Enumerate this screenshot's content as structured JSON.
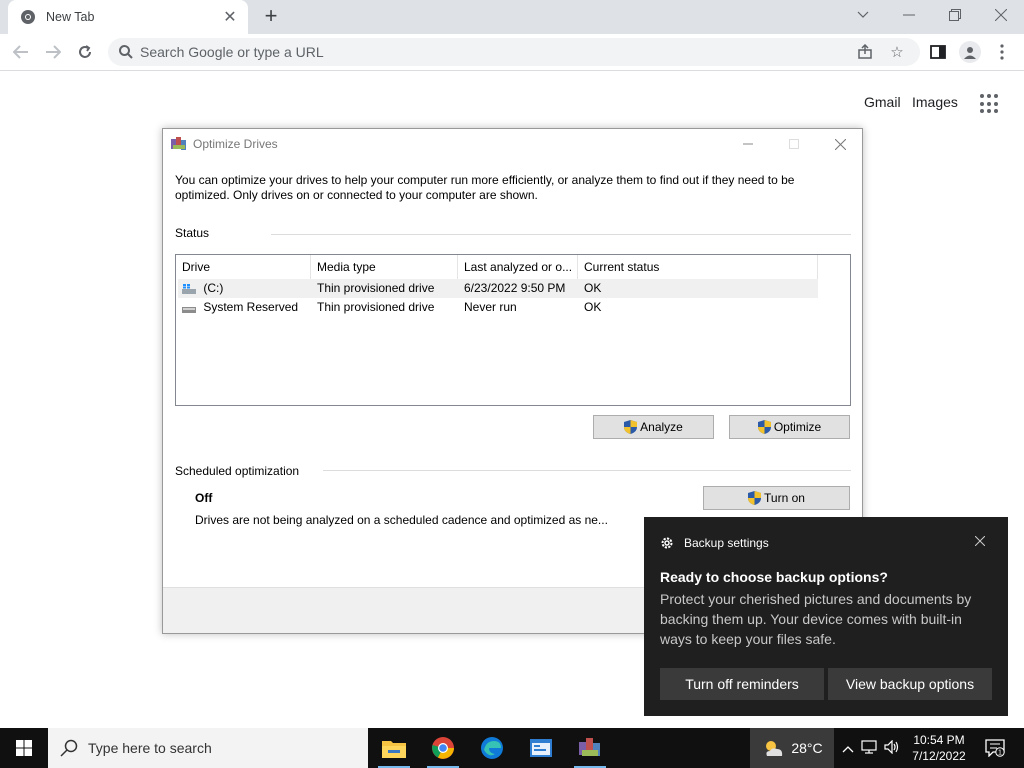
{
  "browser": {
    "tab_title": "New Tab",
    "omnibox_placeholder": "Search Google or type a URL",
    "ntp_links": {
      "gmail": "Gmail",
      "images": "Images"
    }
  },
  "dialog": {
    "title": "Optimize Drives",
    "description": "You can optimize your drives to help your computer run more efficiently, or analyze them to find out if they need to be optimized. Only drives on or connected to your computer are shown.",
    "status_label": "Status",
    "columns": [
      "Drive",
      "Media type",
      "Last analyzed or o...",
      "Current status"
    ],
    "drives": [
      {
        "drive": "(C:)",
        "media_type": "Thin provisioned drive",
        "last_analyzed": "6/23/2022 9:50 PM",
        "status": "OK"
      },
      {
        "drive": "System Reserved",
        "media_type": "Thin provisioned drive",
        "last_analyzed": "Never run",
        "status": "OK"
      }
    ],
    "analyze_label": "Analyze",
    "optimize_label": "Optimize",
    "scheduled_label": "Scheduled optimization",
    "scheduled_state": "Off",
    "scheduled_desc": "Drives are not being analyzed on a scheduled cadence and optimized as ne...",
    "turn_on_label": "Turn on"
  },
  "toast": {
    "app_name": "Backup settings",
    "title": "Ready to choose backup options?",
    "body": "Protect your cherished pictures and documents by backing them up. Your device comes with built-in ways to keep your files safe.",
    "btn_reminders": "Turn off reminders",
    "btn_view": "View backup options"
  },
  "taskbar": {
    "search_placeholder": "Type here to search",
    "weather_temp": "28°C",
    "time": "10:54 PM",
    "date": "7/12/2022",
    "notification_count": "1"
  },
  "colors": {
    "accent": "#76b9ed",
    "toast_bg": "#1f1f1f",
    "taskbar_bg": "#101010"
  }
}
